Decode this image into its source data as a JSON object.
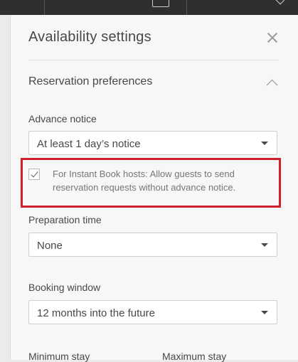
{
  "panel": {
    "title": "Availability settings",
    "section_title": "Reservation preferences"
  },
  "advance_notice": {
    "label": "Advance notice",
    "value": "At least 1 day’s notice"
  },
  "instant_book": {
    "checked": true,
    "text": "For Instant Book hosts: Allow guests to send reservation requests without advance notice."
  },
  "preparation_time": {
    "label": "Preparation time",
    "value": "None"
  },
  "booking_window": {
    "label": "Booking window",
    "value": "12 months into the future"
  },
  "stay": {
    "minimum_label": "Minimum stay",
    "maximum_label": "Maximum stay"
  },
  "icons": {
    "close": "close-icon",
    "collapse": "chevron-up-icon",
    "dropdown": "caret-down-icon",
    "check": "check-icon"
  },
  "colors": {
    "highlight_border": "#d0202e",
    "panel_background": "#f7f7f7",
    "top_bar": "#2f2f2f"
  }
}
